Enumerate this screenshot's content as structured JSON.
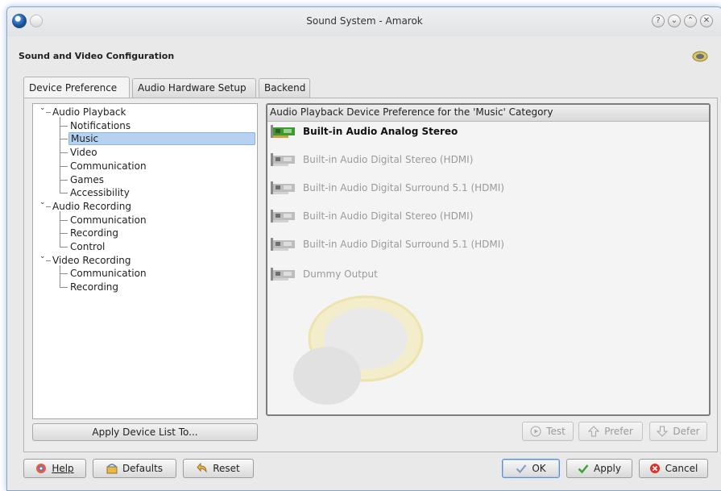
{
  "window": {
    "title": "Sound System - Amarok"
  },
  "header": {
    "title": "Sound and Video Configuration"
  },
  "tabs": [
    {
      "label": "Device Preference",
      "active": true
    },
    {
      "label": "Audio Hardware Setup",
      "active": false
    },
    {
      "label": "Backend",
      "active": false
    }
  ],
  "tree": [
    {
      "label": "Audio Playback",
      "level": 0,
      "expanded": true
    },
    {
      "label": "Notifications",
      "level": 1
    },
    {
      "label": "Music",
      "level": 1,
      "selected": true
    },
    {
      "label": "Video",
      "level": 1
    },
    {
      "label": "Communication",
      "level": 1
    },
    {
      "label": "Games",
      "level": 1
    },
    {
      "label": "Accessibility",
      "level": 1
    },
    {
      "label": "Audio Recording",
      "level": 0,
      "expanded": true
    },
    {
      "label": "Communication",
      "level": 1
    },
    {
      "label": "Recording",
      "level": 1
    },
    {
      "label": "Control",
      "level": 1
    },
    {
      "label": "Video Recording",
      "level": 0,
      "expanded": true
    },
    {
      "label": "Communication",
      "level": 1
    },
    {
      "label": "Recording",
      "level": 1
    }
  ],
  "device_panel": {
    "header": "Audio Playback Device Preference for the 'Music' Category",
    "devices": [
      {
        "name": "Built-in Audio Analog Stereo",
        "enabled": true
      },
      {
        "name": "Built-in Audio Digital Stereo (HDMI)",
        "enabled": false
      },
      {
        "name": "Built-in Audio Digital Surround 5.1 (HDMI)",
        "enabled": false
      },
      {
        "name": "Built-in Audio Digital Stereo (HDMI)",
        "enabled": false
      },
      {
        "name": "Built-in Audio Digital Surround 5.1 (HDMI)",
        "enabled": false
      },
      {
        "name": "Dummy Output",
        "enabled": false
      }
    ]
  },
  "buttons": {
    "apply_device_list": "Apply Device List To...",
    "test": "Test",
    "prefer": "Prefer",
    "defer": "Defer",
    "help": "Help",
    "defaults": "Defaults",
    "reset": "Reset",
    "ok": "OK",
    "apply": "Apply",
    "cancel": "Cancel"
  }
}
